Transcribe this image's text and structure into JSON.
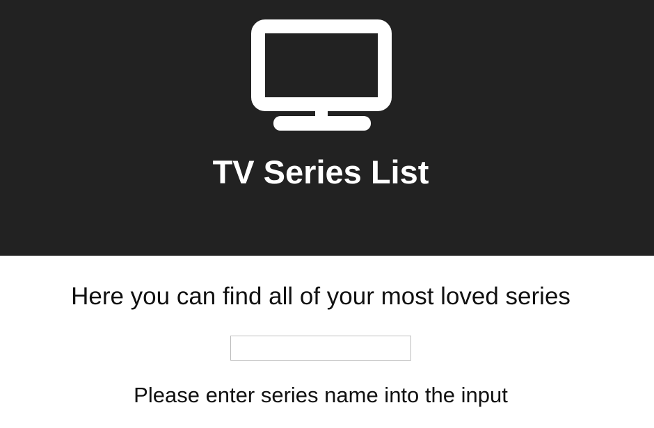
{
  "header": {
    "icon": "tv-icon",
    "title": "TV Series List",
    "background_color": "#222222",
    "text_color": "#ffffff"
  },
  "main": {
    "subtitle": "Here you can find all of your most loved series",
    "search": {
      "value": "",
      "placeholder": ""
    },
    "hint": "Please enter series name into the input"
  }
}
